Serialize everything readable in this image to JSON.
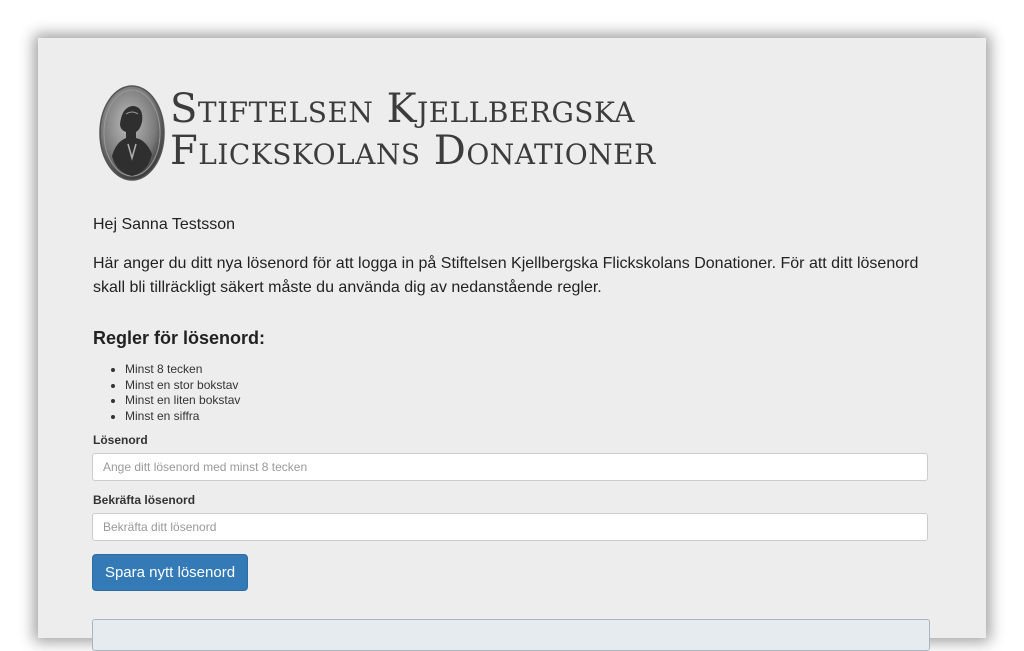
{
  "logo": {
    "line1": "Stiftelsen Kjellbergska",
    "line2": "Flickskolans Donationer"
  },
  "greeting": "Hej Sanna Testsson",
  "intro": "Här anger du ditt nya lösenord för att logga in på Stiftelsen Kjellbergska Flickskolans Donationer. För att ditt lösenord skall bli tillräckligt säkert måste du använda dig av nedanstående regler.",
  "rules": {
    "heading": "Regler för lösenord:",
    "items": [
      "Minst 8 tecken",
      "Minst en stor bokstav",
      "Minst en liten bokstav",
      "Minst en siffra"
    ]
  },
  "password": {
    "label": "Lösenord",
    "placeholder": "Ange ditt lösenord med minst 8 tecken",
    "value": ""
  },
  "confirm": {
    "label": "Bekräfta lösenord",
    "placeholder": "Bekräfta ditt lösenord",
    "value": ""
  },
  "save_button": "Spara nytt lösenord",
  "colors": {
    "button": "#337ab7",
    "panel": "#ededed"
  }
}
